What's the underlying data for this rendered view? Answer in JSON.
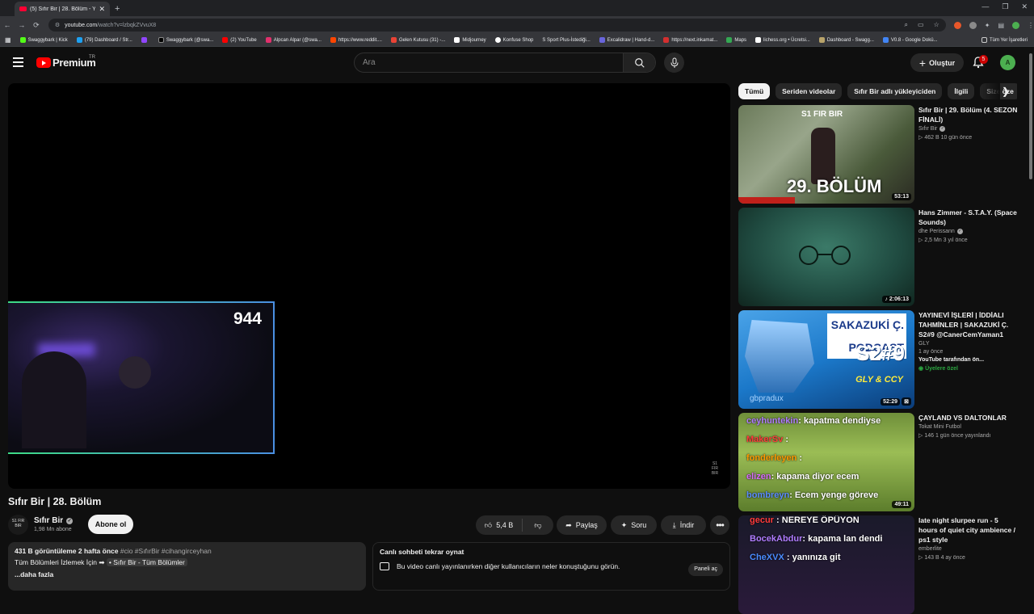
{
  "browser": {
    "tab_title": "(5) Sıfır Bir | 28. Bölüm - YouTube",
    "url_host": "youtube.com",
    "url_path": "/watch?v=lzbqkZVvuX8",
    "bookmarks": [
      {
        "label": "Swaggybark | Kick",
        "color": "#53fc18"
      },
      {
        "label": "(79) Dashboard / Str...",
        "color": "#1da1f2"
      },
      {
        "label": "",
        "color": "#9146ff"
      },
      {
        "label": "Swaggybark (@swa...",
        "color": "#000000"
      },
      {
        "label": "(2) YouTube",
        "color": "#ff0000"
      },
      {
        "label": "Alpcan Alpar (@swa...",
        "color": "#e1306c"
      },
      {
        "label": "https://www.reddit....",
        "color": "#ff4500"
      },
      {
        "label": "Gelen Kutusu (31) -...",
        "color": "#ea4335"
      },
      {
        "label": "Midjourney",
        "color": "#ffffff"
      },
      {
        "label": "Konfuse Shop",
        "color": "#ffffff"
      },
      {
        "label": "S Sport Plus-İstediği...",
        "color": "#222222"
      },
      {
        "label": "Excalidraw | Hand-d...",
        "color": "#6965db"
      },
      {
        "label": "https://next.inkamat...",
        "color": "#d32f2f"
      },
      {
        "label": "Maps",
        "color": "#34a853"
      },
      {
        "label": "lichess.org • Ücretsi...",
        "color": "#ffffff"
      },
      {
        "label": "Dashboard - Swagg...",
        "color": "#b8a36a"
      },
      {
        "label": "V0.8 - Google Dokü...",
        "color": "#4285f4"
      }
    ],
    "bookmarks_right": "Tüm Yer İşaretleri"
  },
  "header": {
    "logo_text": "Premium",
    "logo_sup": "TR",
    "search_placeholder": "Ara",
    "create_label": "Oluştur",
    "notif_count": "5",
    "avatar_initial": "A"
  },
  "player": {
    "facecam_count": "944",
    "watermark": "S1 FIR BIR"
  },
  "video": {
    "title": "Sıfır Bir | 28. Bölüm",
    "channel_name": "Sıfır Bir",
    "channel_avatar": "S1 FIR BIR",
    "subscribers": "1,98 Mn abone",
    "subscribe_label": "Abone ol",
    "likes": "5,4 B",
    "share_label": "Paylaş",
    "ask_label": "Soru",
    "download_label": "İndir"
  },
  "description": {
    "views_date": "431 B görüntüleme  2 hafta önce",
    "tags": " #cio #SıfırBir #cihangirceyhan",
    "line2_prefix": "Tüm Bölümleri İzlemek İçin ➡ ",
    "line2_chip": "• Sıfır Bir - Tüm Bölümler",
    "more": "...daha fazla"
  },
  "chat_replay": {
    "title": "Canlı sohbeti tekrar oynat",
    "text": "Bu video canlı yayınlanırken diğer kullanıcıların neler konuştuğunu görün.",
    "panel_button": "Paneli aç"
  },
  "chips": [
    "Tümü",
    "Seriden videolar",
    "Sıfır Bir adlı yükleyiciden",
    "İlgili",
    "Size öze"
  ],
  "recommendations": [
    {
      "title": "Sıfır Bir | 29. Bölüm (4. SEZON FİNALİ)",
      "channel": "Sıfır Bir",
      "stats": "▷ 462 B   10 gün önce",
      "duration": "53:13",
      "thumb_big": "29. BÖLÜM",
      "thumb_small": "S1 FIR BIR"
    },
    {
      "title": "Hans Zimmer - S.T.A.Y. (Space Sounds)",
      "channel": "dhe Perissann",
      "stats": "▷ 2,5 Mn   3 yıl önce",
      "duration": "♪ 2:06:13"
    },
    {
      "title": "YAYINEVİ İŞLERİ | İDDİALI TAHMİNLER | SAKAZUKİ Ç. S2#9 @CanerCemYaman1",
      "channel": "GLY",
      "stats": "1 ay önce",
      "extra": "YouTube tarafından ön...",
      "members": "Üyelere özel",
      "duration": "52:29",
      "thumb_tx1": "SAKAZUKİ Ç. PODCAST",
      "thumb_tx2": "S2#9",
      "thumb_tx3": "GLY & CCY",
      "thumb_tx4": "gbpradux"
    },
    {
      "title": "ÇAYLAND VS DALTONLAR",
      "channel": "Tokat Mini Futbol",
      "stats": "▷ 146   1 gün önce yayınlandı",
      "duration": "49:11",
      "chat": [
        {
          "user": "ceyhuntekin",
          "msg": ": kapatma dendiyse",
          "color": "#b07cff"
        },
        {
          "user": "MakerSv",
          "msg": ":",
          "color": "#ff3b3b"
        },
        {
          "user": "fonderleyen",
          "msg": ":",
          "color": "#ff9900"
        },
        {
          "user": "elizen",
          "msg": ": kapama diyor ecem",
          "color": "#d86bff"
        },
        {
          "user": "bombreyn",
          "msg": ": Ecem yenge göreve",
          "color": "#5b8cff"
        }
      ]
    },
    {
      "title": "late night slurpee run - 5 hours of quiet city ambience / ps1 style",
      "channel": "emberlite",
      "stats": "▷ 143 B   4 ay önce",
      "chat": [
        {
          "user": "gecur",
          "msg": ": NEREYE ÖPÜYON",
          "color": "#ff3b3b"
        },
        {
          "user": "BocekAbdur",
          "msg": ": kapama lan dendi",
          "color": "#b07cff"
        },
        {
          "user": "CheXVX",
          "msg": ": yanınıza git",
          "color": "#4a8cff"
        }
      ]
    }
  ]
}
